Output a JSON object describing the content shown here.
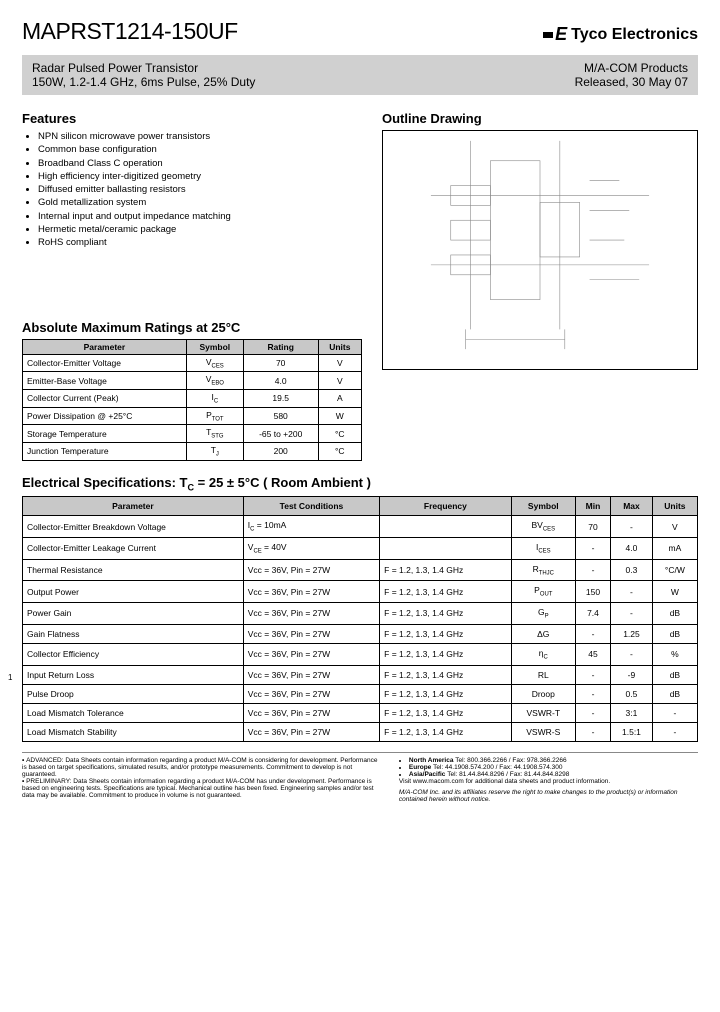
{
  "header": {
    "part_number": "MAPRST1214-150UF",
    "company": "Tyco Electronics"
  },
  "subheader": {
    "title": "Radar Pulsed Power Transistor",
    "spec": "150W, 1.2-1.4 GHz, 6ms Pulse, 25% Duty",
    "product_line": "M/A-COM Products",
    "release": "Released, 30 May 07"
  },
  "sections": {
    "features": "Features",
    "outline": "Outline Drawing",
    "ratings": "Absolute Maximum Ratings at 25°C",
    "elec": "Electrical Specifications:  T",
    "elec_sub": "C",
    "elec_rest": " = 25 ± 5°C ( Room Ambient )"
  },
  "features": [
    "NPN silicon microwave power transistors",
    "Common base configuration",
    "Broadband Class C operation",
    "High efficiency inter-digitized geometry",
    "Diffused emitter ballasting resistors",
    "Gold metallization system",
    "Internal input and output impedance matching",
    "Hermetic metal/ceramic package",
    "RoHS compliant"
  ],
  "ratings_headers": [
    "Parameter",
    "Symbol",
    "Rating",
    "Units"
  ],
  "ratings": [
    {
      "param": "Collector-Emitter Voltage",
      "sym": "V_CES",
      "rating": "70",
      "units": "V"
    },
    {
      "param": "Emitter-Base Voltage",
      "sym": "V_EBO",
      "rating": "4.0",
      "units": "V"
    },
    {
      "param": "Collector Current (Peak)",
      "sym": "I_C",
      "rating": "19.5",
      "units": "A"
    },
    {
      "param": "Power Dissipation @ +25°C",
      "sym": "P_TOT",
      "rating": "580",
      "units": "W"
    },
    {
      "param": "Storage Temperature",
      "sym": "T_STG",
      "rating": "-65 to +200",
      "units": "°C"
    },
    {
      "param": "Junction Temperature",
      "sym": "T_J",
      "rating": "200",
      "units": "°C"
    }
  ],
  "elec_headers": [
    "Parameter",
    "Test Conditions",
    "Frequency",
    "Symbol",
    "Min",
    "Max",
    "Units"
  ],
  "elec_rows": [
    {
      "param": "Collector-Emitter Breakdown Voltage",
      "cond": "I_C = 10mA",
      "freq": "",
      "sym": "BV_CES",
      "min": "70",
      "max": "-",
      "units": "V"
    },
    {
      "param": "Collector-Emitter Leakage Current",
      "cond": "V_CE = 40V",
      "freq": "",
      "sym": "I_CES",
      "min": "-",
      "max": "4.0",
      "units": "mA"
    },
    {
      "param": "Thermal Resistance",
      "cond": "Vcc = 36V,  Pin = 27W",
      "freq": "F = 1.2, 1.3, 1.4 GHz",
      "sym": "R_THJC",
      "min": "-",
      "max": "0.3",
      "units": "°C/W"
    },
    {
      "param": "Output Power",
      "cond": "Vcc = 36V,  Pin = 27W",
      "freq": "F = 1.2, 1.3, 1.4 GHz",
      "sym": "P_OUT",
      "min": "150",
      "max": "-",
      "units": "W"
    },
    {
      "param": "Power Gain",
      "cond": "Vcc = 36V,  Pin = 27W",
      "freq": "F = 1.2, 1.3, 1.4 GHz",
      "sym": "G_P",
      "min": "7.4",
      "max": "-",
      "units": "dB"
    },
    {
      "param": "Gain Flatness",
      "cond": "Vcc = 36V,  Pin = 27W",
      "freq": "F = 1.2, 1.3, 1.4 GHz",
      "sym": "ΔG",
      "min": "-",
      "max": "1.25",
      "units": "dB"
    },
    {
      "param": "Collector Efficiency",
      "cond": "Vcc = 36V,  Pin = 27W",
      "freq": "F = 1.2, 1.3, 1.4 GHz",
      "sym": "η_C",
      "min": "45",
      "max": "-",
      "units": "%"
    },
    {
      "param": "Input Return Loss",
      "cond": "Vcc = 36V,  Pin = 27W",
      "freq": "F = 1.2, 1.3, 1.4 GHz",
      "sym": "RL",
      "min": "-",
      "max": "-9",
      "units": "dB"
    },
    {
      "param": "Pulse Droop",
      "cond": "Vcc = 36V,  Pin = 27W",
      "freq": "F = 1.2, 1.3, 1.4 GHz",
      "sym": "Droop",
      "min": "-",
      "max": "0.5",
      "units": "dB"
    },
    {
      "param": "Load Mismatch Tolerance",
      "cond": "Vcc = 36V,  Pin = 27W",
      "freq": "F = 1.2, 1.3, 1.4 GHz",
      "sym": "VSWR-T",
      "min": "-",
      "max": "3:1",
      "units": "-"
    },
    {
      "param": "Load Mismatch Stability",
      "cond": "Vcc = 36V,  Pin = 27W",
      "freq": "F = 1.2, 1.3, 1.4 GHz",
      "sym": "VSWR-S",
      "min": "-",
      "max": "1.5:1",
      "units": "-"
    }
  ],
  "footer": {
    "advanced": "ADVANCED: Data Sheets contain information regarding a product M/A-COM is considering for development. Performance is based on target specifications, simulated results, and/or prototype measurements. Commitment to develop is not guaranteed.",
    "preliminary": "PRELIMINARY: Data Sheets contain information regarding a product M/A-COM has under development. Performance is based on engineering tests. Specifications are typical. Mechanical outline has been fixed. Engineering samples and/or test data may be available. Commitment to produce in volume is not guaranteed.",
    "contacts": [
      "North America  Tel: 800.366.2266 / Fax: 978.366.2266",
      "Europe  Tel: 44.1908.574.200 / Fax: 44.1908.574.300",
      "Asia/Pacific  Tel: 81.44.844.8296 / Fax: 81.44.844.8298"
    ],
    "visit": "Visit www.macom.com for additional data sheets and product information.",
    "disclaimer": "M/A-COM Inc. and its affiliates reserve the right to make changes to the product(s) or information contained herein without notice."
  },
  "page": "1"
}
